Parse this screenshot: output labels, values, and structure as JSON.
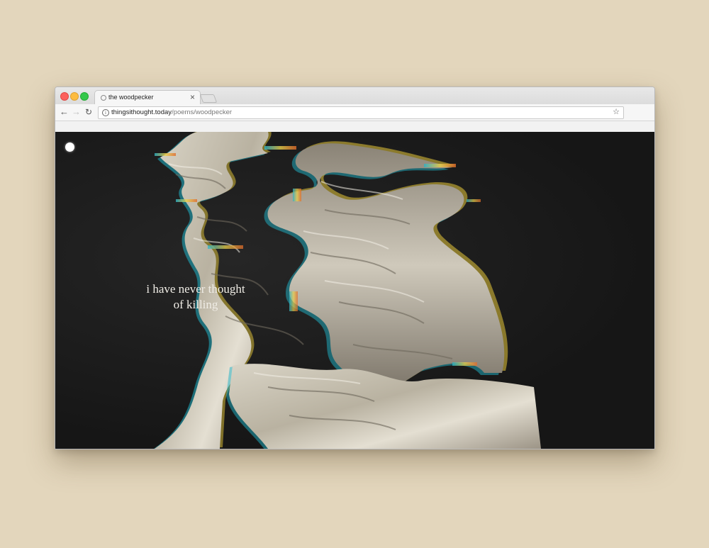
{
  "browser": {
    "tab_title": "the woodpecker",
    "tab_close": "×",
    "url_domain": "thingsithought.today",
    "url_path": "/poems/woodpecker",
    "icons": {
      "back": "arrow-left-icon",
      "forward": "arrow-right-icon",
      "reload": "reload-icon",
      "info": "info-icon",
      "bookmark": "star-icon"
    }
  },
  "page": {
    "poem_line_1": "i have never thought",
    "poem_line_2": "of killing"
  },
  "colors": {
    "backdrop": "#e3d6bc",
    "page_background": "#161616",
    "poem_text": "#f0ede6"
  }
}
